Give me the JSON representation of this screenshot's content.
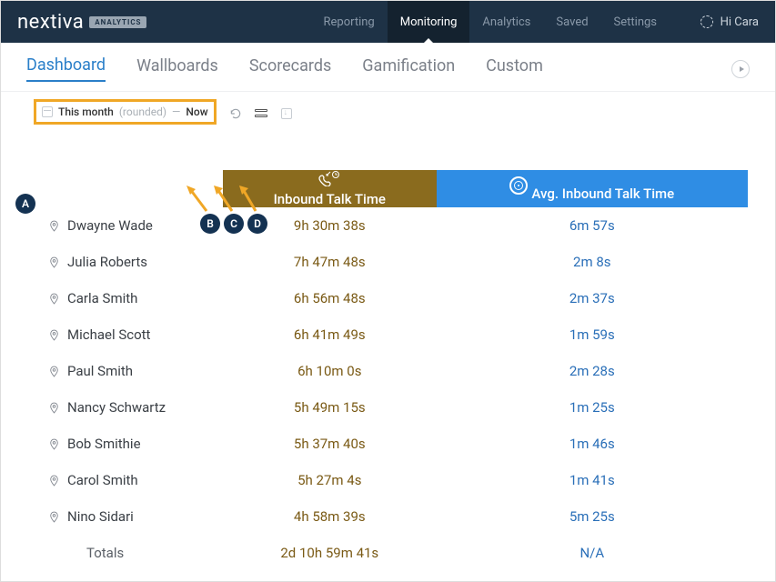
{
  "brand": {
    "name": "nextiva",
    "badge": "ANALYTICS"
  },
  "topnav": {
    "items": [
      "Reporting",
      "Monitoring",
      "Analytics",
      "Saved",
      "Settings"
    ],
    "active": "Monitoring",
    "user_greeting": "Hi Cara"
  },
  "subnav": {
    "items": [
      "Dashboard",
      "Wallboards",
      "Scorecards",
      "Gamification",
      "Custom"
    ],
    "active": "Dashboard"
  },
  "toolbar": {
    "range_main": "This month",
    "range_qualifier": "(rounded)",
    "range_sep": "—",
    "range_end": "Now"
  },
  "annotations": {
    "a": "A",
    "b": "B",
    "c": "C",
    "d": "D"
  },
  "table": {
    "headers": {
      "name": "",
      "inbound": "Inbound Talk Time",
      "avg": "Avg. Inbound Talk Time"
    },
    "rows": [
      {
        "name": "Dwayne Wade",
        "inbound": "9h 30m 38s",
        "avg": "6m 57s"
      },
      {
        "name": "Julia Roberts",
        "inbound": "7h 47m 48s",
        "avg": "2m 8s"
      },
      {
        "name": "Carla Smith",
        "inbound": "6h 56m 48s",
        "avg": "2m 37s"
      },
      {
        "name": "Michael Scott",
        "inbound": "6h 41m 49s",
        "avg": "1m 59s"
      },
      {
        "name": "Paul Smith",
        "inbound": "6h 10m 0s",
        "avg": "2m 28s"
      },
      {
        "name": "Nancy Schwartz",
        "inbound": "5h 49m 15s",
        "avg": "1m 25s"
      },
      {
        "name": "Bob Smithie",
        "inbound": "5h 37m 40s",
        "avg": "1m 46s"
      },
      {
        "name": "Carol Smith",
        "inbound": "5h 27m 4s",
        "avg": "1m 41s"
      },
      {
        "name": "Nino Sidari",
        "inbound": "4h 58m 39s",
        "avg": "5m 25s"
      }
    ],
    "totals": {
      "label": "Totals",
      "inbound": "2d 10h 59m 41s",
      "avg": "N/A"
    }
  }
}
